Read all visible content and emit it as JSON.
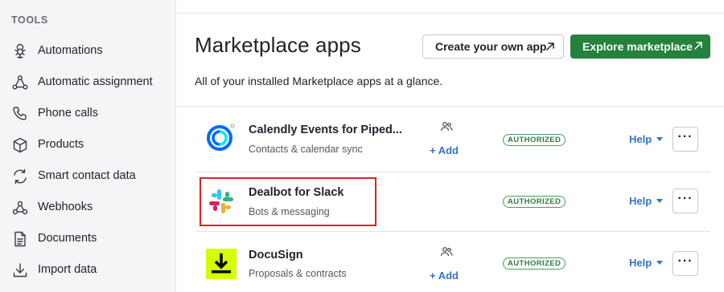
{
  "sidebar": {
    "heading": "TOOLS",
    "items": [
      {
        "label": "Automations",
        "icon": "automations-icon"
      },
      {
        "label": "Automatic assignment",
        "icon": "assignment-icon"
      },
      {
        "label": "Phone calls",
        "icon": "phone-icon"
      },
      {
        "label": "Products",
        "icon": "box-icon"
      },
      {
        "label": "Smart contact data",
        "icon": "sync-icon"
      },
      {
        "label": "Webhooks",
        "icon": "webhook-icon"
      },
      {
        "label": "Documents",
        "icon": "document-icon"
      },
      {
        "label": "Import data",
        "icon": "import-icon"
      }
    ]
  },
  "main": {
    "title": "Marketplace apps",
    "subtitle": "All of your installed Marketplace apps at a glance.",
    "create_button": "Create your own app",
    "explore_button": "Explore marketplace",
    "apps": [
      {
        "name": "Calendly Events for Piped...",
        "category": "Contacts & calendar sync",
        "add_label": "+ Add",
        "status": "AUTHORIZED",
        "help_label": "Help",
        "more_label": "···"
      },
      {
        "name": "Dealbot for Slack",
        "category": "Bots & messaging",
        "status": "AUTHORIZED",
        "help_label": "Help",
        "more_label": "···"
      },
      {
        "name": "DocuSign",
        "category": "Proposals & contracts",
        "add_label": "+ Add",
        "status": "AUTHORIZED",
        "help_label": "Help",
        "more_label": "···"
      }
    ]
  },
  "colors": {
    "primary_green": "#26803e",
    "link_blue": "#3372c4",
    "highlight_red": "#e01f26",
    "authorized_green": "#43a05a"
  }
}
